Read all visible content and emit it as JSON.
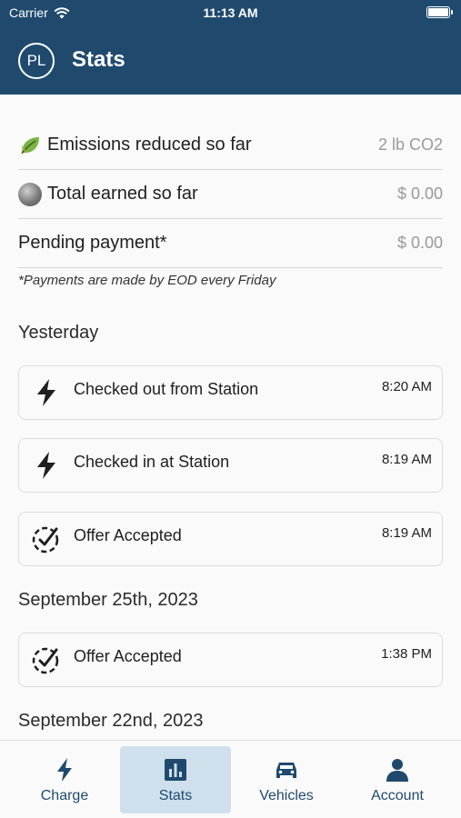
{
  "status_bar": {
    "carrier": "Carrier",
    "time": "11:13 AM"
  },
  "header": {
    "logo": "PL",
    "title": "Stats"
  },
  "summary": [
    {
      "icon": "leaf-icon",
      "label": "Emissions reduced so far",
      "value": "2 lb CO2"
    },
    {
      "icon": "coin-icon",
      "label": "Total earned so far",
      "value": "$ 0.00"
    },
    {
      "icon": "",
      "label": "Pending payment*",
      "value": "$ 0.00"
    }
  ],
  "footnote": "*Payments are made by EOD every Friday",
  "sections": [
    {
      "title": "Yesterday",
      "items": [
        {
          "icon": "lightning-bolt-icon",
          "label": "Checked out from Station",
          "time": "8:20 AM"
        },
        {
          "icon": "lightning-bolt-icon",
          "label": "Checked in at Station",
          "time": "8:19 AM"
        },
        {
          "icon": "check-circle-icon",
          "label": "Offer Accepted",
          "time": "8:19 AM"
        }
      ]
    },
    {
      "title": "September 25th, 2023",
      "items": [
        {
          "icon": "check-circle-icon",
          "label": "Offer Accepted",
          "time": "1:38 PM"
        }
      ]
    },
    {
      "title": "September 22nd, 2023",
      "items": []
    }
  ],
  "tabs": [
    {
      "icon": "lightning-bolt-icon",
      "label": "Charge",
      "active": false
    },
    {
      "icon": "bar-chart-icon",
      "label": "Stats",
      "active": true
    },
    {
      "icon": "car-icon",
      "label": "Vehicles",
      "active": false
    },
    {
      "icon": "person-icon",
      "label": "Account",
      "active": false
    }
  ],
  "colors": {
    "header_bg": "#1f4a6e",
    "tab_active_bg": "#cfe0ec",
    "tab_text": "#1f4a6e"
  }
}
